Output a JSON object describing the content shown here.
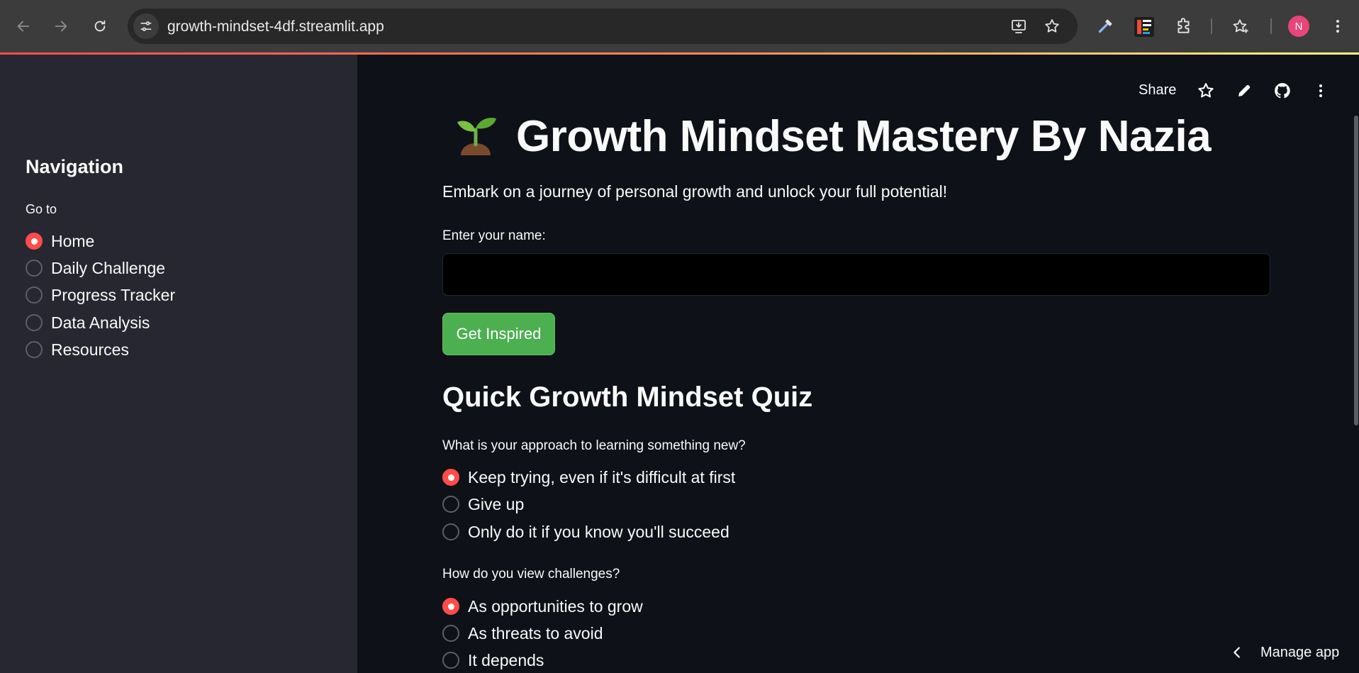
{
  "browser": {
    "url": "growth-mindset-4df.streamlit.app",
    "profile_initial": "N",
    "colors": {
      "accent": "#ff4b4b",
      "profile": "#e8457a"
    }
  },
  "sidebar": {
    "title": "Navigation",
    "radio_label": "Go to",
    "items": [
      {
        "label": "Home",
        "selected": true
      },
      {
        "label": "Daily Challenge",
        "selected": false
      },
      {
        "label": "Progress Tracker",
        "selected": false
      },
      {
        "label": "Data Analysis",
        "selected": false
      },
      {
        "label": "Resources",
        "selected": false
      }
    ]
  },
  "toolbar": {
    "share_label": "Share"
  },
  "main": {
    "title_icon": "seedling-emoji",
    "title": "Growth Mindset Mastery By Nazia",
    "subtitle": "Embark on a journey of personal growth and unlock your full potential!",
    "name_label": "Enter your name:",
    "name_value": "",
    "button_label": "Get Inspired",
    "button_color": "#4caf50",
    "quiz_heading": "Quick Growth Mindset Quiz",
    "questions": [
      {
        "question": "What is your approach to learning something new?",
        "options": [
          {
            "label": "Keep trying, even if it's difficult at first",
            "selected": true
          },
          {
            "label": "Give up",
            "selected": false
          },
          {
            "label": "Only do it if you know you'll succeed",
            "selected": false
          }
        ]
      },
      {
        "question": "How do you view challenges?",
        "options": [
          {
            "label": "As opportunities to grow",
            "selected": true
          },
          {
            "label": "As threats to avoid",
            "selected": false
          },
          {
            "label": "It depends",
            "selected": false
          }
        ]
      }
    ]
  },
  "footer": {
    "manage_app_label": "Manage app"
  }
}
